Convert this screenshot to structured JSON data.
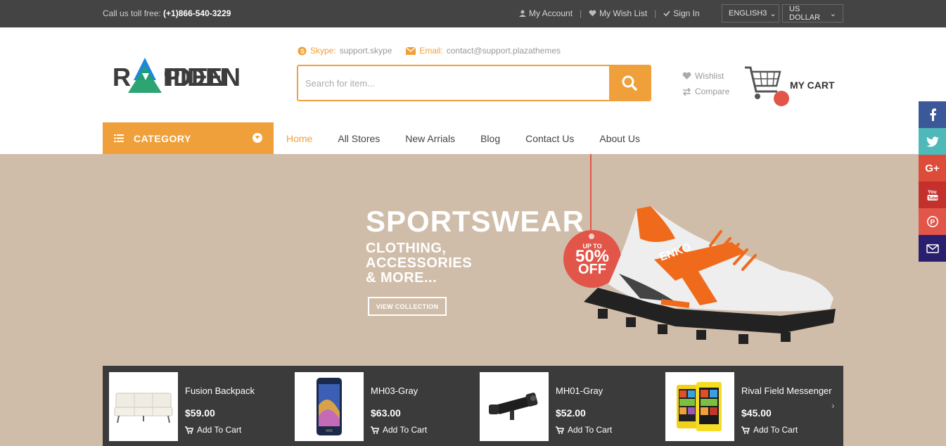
{
  "topbar": {
    "tollfree_label": "Call us toll free:",
    "tollfree_number": "(+1)866-540-3229",
    "my_account": "My Account",
    "my_wishlist": "My Wish List",
    "sign_in": "Sign In",
    "language": "ENGLISH3",
    "currency": "US DOLLAR"
  },
  "header": {
    "logo_text": "RAPIDEN",
    "skype_key": "Skype:",
    "skype_value": "support.skype",
    "email_key": "Email:",
    "email_value": "contact@support.plazathemes",
    "search_placeholder": "Search for item...",
    "wishlist": "Wishlist",
    "compare": "Compare",
    "cart_label": "MY CART"
  },
  "nav": {
    "category_label": "CATEGORY",
    "items": [
      {
        "label": "Home",
        "active": true
      },
      {
        "label": "All Stores"
      },
      {
        "label": "New Arrials"
      },
      {
        "label": "Blog"
      },
      {
        "label": "Contact Us"
      },
      {
        "label": "About Us"
      }
    ]
  },
  "hero": {
    "title": "SPORTSWEAR",
    "line1": "CLOTHING,",
    "line2": "ACCESSORIES",
    "line3": "& MORE...",
    "cta": "VIEW COLLECTION",
    "badge_upto": "UP TO",
    "badge_pct": "50%",
    "badge_off": "OFF",
    "shoe_brand": "ENKO"
  },
  "products": [
    {
      "name": "Fusion Backpack",
      "price": "$59.00",
      "cta": "Add To Cart",
      "thumb_icon": "sofa-icon"
    },
    {
      "name": "MH03-Gray",
      "price": "$63.00",
      "cta": "Add To Cart",
      "thumb_icon": "phone-icon"
    },
    {
      "name": "MH01-Gray",
      "price": "$52.00",
      "cta": "Add To Cart",
      "thumb_icon": "scope-icon"
    },
    {
      "name": "Rival Field Messenger",
      "price": "$45.00",
      "cta": "Add To Cart",
      "thumb_icon": "phone-yellow-icon"
    }
  ],
  "social": [
    {
      "name": "facebook-icon",
      "glyph": "f",
      "color": "#3b5998"
    },
    {
      "name": "twitter-icon",
      "glyph": "t",
      "color": "#4fb8b8"
    },
    {
      "name": "google-plus-icon",
      "glyph": "G+",
      "color": "#dd4b39"
    },
    {
      "name": "youtube-icon",
      "glyph": "You",
      "color": "#c4302b"
    },
    {
      "name": "pinterest-icon",
      "glyph": "P",
      "color": "#e25549"
    },
    {
      "name": "email-icon",
      "glyph": "✉",
      "color": "#2a1f6e"
    }
  ],
  "colors": {
    "accent": "#f0a03a",
    "topbar_bg": "#444444",
    "hero_bg": "#d0bda9",
    "badge": "#e25549",
    "product_strip": "#3b3b3b"
  }
}
